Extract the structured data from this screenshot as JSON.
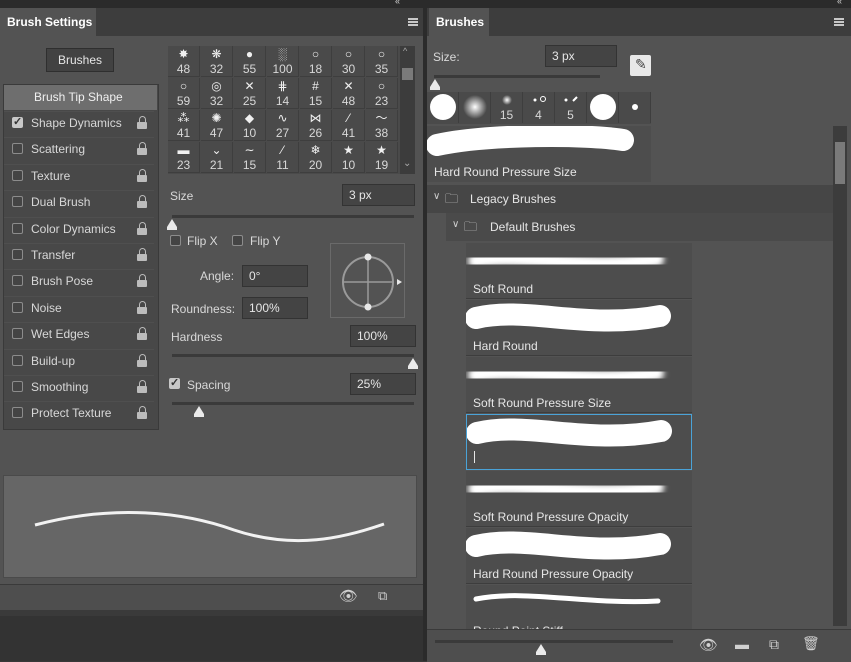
{
  "left_panel": {
    "tab_title": "Brush Settings",
    "brushes_button": "Brushes",
    "brush_tip_shape": "Brush Tip Shape",
    "options": [
      {
        "label": "Shape Dynamics",
        "checked": true
      },
      {
        "label": "Scattering",
        "checked": false
      },
      {
        "label": "Texture",
        "checked": false
      },
      {
        "label": "Dual Brush",
        "checked": false
      },
      {
        "label": "Color Dynamics",
        "checked": false
      },
      {
        "label": "Transfer",
        "checked": false
      },
      {
        "label": "Brush Pose",
        "checked": false
      },
      {
        "label": "Noise",
        "checked": false
      },
      {
        "label": "Wet Edges",
        "checked": false
      },
      {
        "label": "Build-up",
        "checked": false
      },
      {
        "label": "Smoothing",
        "checked": false
      },
      {
        "label": "Protect Texture",
        "checked": false
      }
    ],
    "tip_rows": [
      [
        {
          "g": "✸",
          "n": "48"
        },
        {
          "g": "❋",
          "n": "32"
        },
        {
          "g": "●",
          "n": "55"
        },
        {
          "g": "░",
          "n": "100"
        },
        {
          "g": "○",
          "n": "18"
        },
        {
          "g": "○",
          "n": "30"
        },
        {
          "g": "○",
          "n": "35"
        }
      ],
      [
        {
          "g": "○",
          "n": "59"
        },
        {
          "g": "◎",
          "n": "32"
        },
        {
          "g": "✕",
          "n": "25"
        },
        {
          "g": "⋕",
          "n": "14"
        },
        {
          "g": "#",
          "n": "15"
        },
        {
          "g": "✕",
          "n": "48"
        },
        {
          "g": "○",
          "n": "23"
        }
      ],
      [
        {
          "g": "⁂",
          "n": "41"
        },
        {
          "g": "✺",
          "n": "47"
        },
        {
          "g": "◆",
          "n": "10"
        },
        {
          "g": "∿",
          "n": "27"
        },
        {
          "g": "⋈",
          "n": "26"
        },
        {
          "g": "⁄",
          "n": "41"
        },
        {
          "g": "〜",
          "n": "38"
        }
      ],
      [
        {
          "g": "▬",
          "n": "23"
        },
        {
          "g": "⌄",
          "n": "21"
        },
        {
          "g": "∼",
          "n": "15"
        },
        {
          "g": "⁄",
          "n": "11"
        },
        {
          "g": "❄",
          "n": "20"
        },
        {
          "g": "★",
          "n": "10"
        },
        {
          "g": "★",
          "n": "19"
        }
      ]
    ],
    "size_label": "Size",
    "size_value": "3 px",
    "flip_x": "Flip X",
    "flip_y": "Flip Y",
    "angle_label": "Angle:",
    "angle_value": "0°",
    "roundness_label": "Roundness:",
    "roundness_value": "100%",
    "hardness_label": "Hardness",
    "hardness_value": "100%",
    "spacing_label": "Spacing",
    "spacing_value": "25%",
    "spacing_checked": true
  },
  "right_panel": {
    "tab_title": "Brushes",
    "size_label": "Size:",
    "size_value": "3 px",
    "recent_tips": [
      {
        "n": ""
      },
      {
        "n": ""
      },
      {
        "n": "15"
      },
      {
        "n": "4"
      },
      {
        "n": "5"
      },
      {
        "n": ""
      },
      {
        "n": ""
      }
    ],
    "current_brush": "Hard Round Pressure Size",
    "folders": [
      {
        "name": "Legacy Brushes"
      },
      {
        "name": "Default Brushes"
      }
    ],
    "brushes": [
      {
        "name": "Soft Round",
        "style": "soft"
      },
      {
        "name": "Hard Round",
        "style": "hard"
      },
      {
        "name": "Soft Round Pressure Size",
        "style": "soft"
      },
      {
        "name": "",
        "style": "hard",
        "selected": true
      },
      {
        "name": "Soft Round Pressure Opacity",
        "style": "soft"
      },
      {
        "name": "Hard Round Pressure Opacity",
        "style": "hard"
      },
      {
        "name": "Round Point Stiff",
        "style": "thin"
      }
    ]
  }
}
